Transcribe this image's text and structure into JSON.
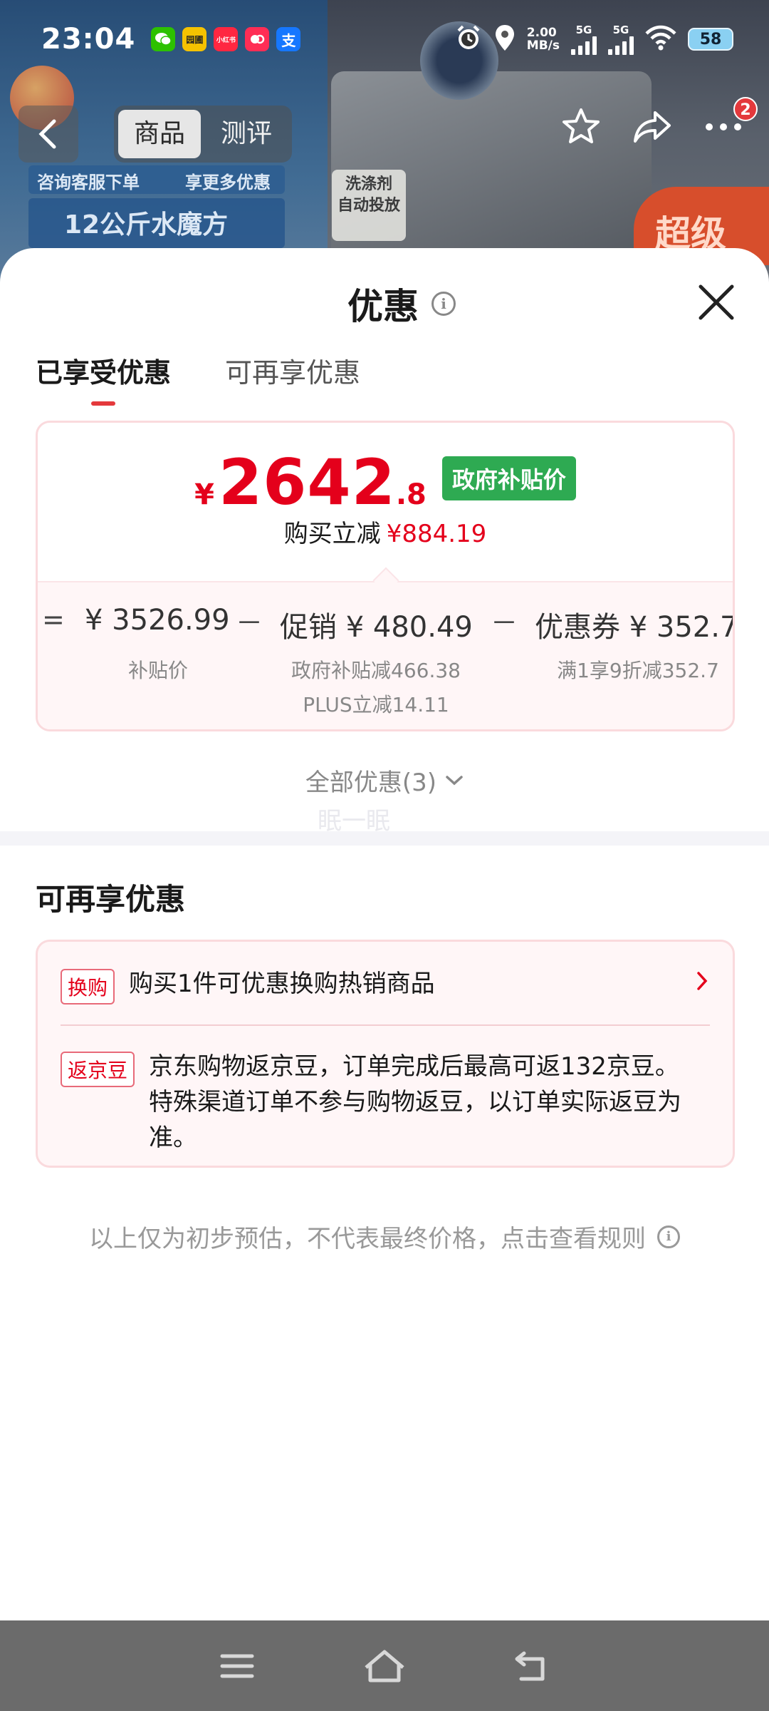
{
  "status_bar": {
    "time": "23:04",
    "apps": [
      {
        "icon": "wechat-icon",
        "label": "",
        "color": "#2dc100"
      },
      {
        "icon": "app-icon",
        "label": "园圃",
        "color": "#f5c200"
      },
      {
        "icon": "xiaohongshu-icon",
        "label": "小红书",
        "color": "#ff2741"
      },
      {
        "icon": "app-icon",
        "label": "",
        "color": "#ff2d55"
      },
      {
        "icon": "alipay-icon",
        "label": "支",
        "color": "#1677ff"
      }
    ],
    "speed_value": "2.00",
    "speed_unit": "MB/s",
    "sim1": "5G",
    "sim2": "5G",
    "battery": "58"
  },
  "background": {
    "label_1": "咨询客服下单",
    "label_2": "享更多优惠",
    "label_3": "12公斤水魔方",
    "sticker_line1": "洗涤剂",
    "sticker_line2": "自动投放",
    "promo": "超级"
  },
  "product_nav": {
    "tabs": [
      "商品",
      "测评"
    ],
    "active_tab": 0,
    "cart_badge": "2"
  },
  "sheet": {
    "title": "优惠",
    "tabs": [
      "已享受优惠",
      "可再享优惠"
    ],
    "active_tab": 0,
    "price": {
      "currency": "¥",
      "integer": "2642",
      "decimal": ".8",
      "tag": "政府补贴价",
      "reduce_label": "购买立减",
      "reduce_amount": "¥884.19"
    },
    "breakdown": {
      "eq": "=",
      "minus": "－",
      "base_value": "¥ 3526.99",
      "base_label": "补贴价",
      "promo_value": "促销 ¥ 480.49",
      "promo_sub1": "政府补贴减466.38",
      "promo_sub2": "PLUS立减14.11",
      "coupon_value": "优惠券 ¥ 352.7",
      "coupon_sub": "满1享9折减352.7"
    },
    "all_offers": "全部优惠(3)",
    "ghost": "眠一眠",
    "section_title": "可再享优惠",
    "offers": [
      {
        "tag": "换购",
        "text": "购买1件可优惠换购热销商品"
      },
      {
        "tag": "返京豆",
        "text": "京东购物返京豆，订单完成后最高可返132京豆。特殊渠道订单不参与购物返豆，以订单实际返豆为准。"
      }
    ],
    "footer": "以上仅为初步预估，不代表最终价格，点击查看规则"
  },
  "colors": {
    "accent_red": "#e4001b",
    "subsidy_green": "#2eaa52"
  }
}
